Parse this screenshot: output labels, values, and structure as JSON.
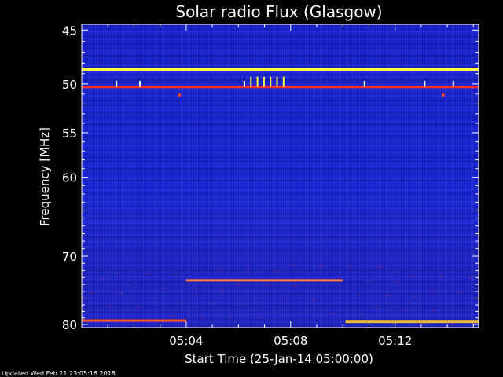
{
  "chart_data": {
    "type": "heatmap",
    "title": "Solar radio Flux (Glasgow)",
    "xlabel": "Start Time (25-Jan-14 05:00:00)",
    "ylabel": "Frequency [MHz]",
    "x_unit": "minutes after 05:00:00",
    "xlim": [
      0,
      15.2
    ],
    "ylim": [
      44.5,
      80.5
    ],
    "y_scale": "log",
    "y_inverted": true,
    "x_ticks": [
      {
        "value": 4,
        "label": "05:04"
      },
      {
        "value": 8,
        "label": "05:08"
      },
      {
        "value": 12,
        "label": "05:12"
      }
    ],
    "y_ticks": [
      {
        "value": 45,
        "label": "45"
      },
      {
        "value": 50,
        "label": "50"
      },
      {
        "value": 55,
        "label": "55"
      },
      {
        "value": 60,
        "label": "60"
      },
      {
        "value": 70,
        "label": "70"
      },
      {
        "value": 80,
        "label": "80"
      }
    ],
    "background_color": "#1e2ad8",
    "features": [
      {
        "name": "band-48.6MHz",
        "type": "band",
        "freq": 48.6,
        "x": [
          0,
          15.2
        ],
        "color": "#ffff40"
      },
      {
        "name": "band-50.3MHz",
        "type": "band",
        "freq": 50.3,
        "x": [
          0,
          15.2
        ],
        "color": "#ff3020"
      },
      {
        "name": "interference-73.4MHz",
        "type": "band",
        "freq": 73.4,
        "x": [
          4.0,
          10.0
        ],
        "color": "#ff7a3a"
      },
      {
        "name": "band-79.4MHz-early",
        "type": "band",
        "freq": 79.4,
        "x": [
          0,
          4.0
        ],
        "color": "#ff5a1a"
      },
      {
        "name": "band-79.6MHz-late",
        "type": "band",
        "freq": 79.6,
        "x": [
          10.1,
          15.2
        ],
        "color": "#e8b838"
      }
    ],
    "spikes": [
      {
        "t": 1.3,
        "freq": 49.7,
        "color": "#ffffff"
      },
      {
        "t": 2.2,
        "freq": 49.7,
        "color": "#ffffff"
      },
      {
        "t": 6.2,
        "freq": 49.7,
        "color": "#ffffff"
      },
      {
        "t": 6.45,
        "freq": 49.3,
        "color": "#ffff40"
      },
      {
        "t": 6.7,
        "freq": 49.3,
        "color": "#ffff40"
      },
      {
        "t": 6.95,
        "freq": 49.3,
        "color": "#ffff40"
      },
      {
        "t": 7.2,
        "freq": 49.3,
        "color": "#ffff40"
      },
      {
        "t": 7.45,
        "freq": 49.3,
        "color": "#ffff40"
      },
      {
        "t": 7.7,
        "freq": 49.3,
        "color": "#ffff40"
      },
      {
        "t": 10.8,
        "freq": 49.7,
        "color": "#ffffff"
      },
      {
        "t": 13.1,
        "freq": 49.7,
        "color": "#ffffff"
      },
      {
        "t": 14.2,
        "freq": 49.7,
        "color": "#ffffff"
      }
    ],
    "blips": [
      {
        "t": 3.7,
        "freq": 51.1,
        "color": "#ff4020"
      },
      {
        "t": 13.8,
        "freq": 51.1,
        "color": "#ff4020"
      }
    ],
    "grid": false,
    "legend": false
  },
  "footer": {
    "updated": "Updated Wed Feb 21 23:05:16 2018"
  }
}
